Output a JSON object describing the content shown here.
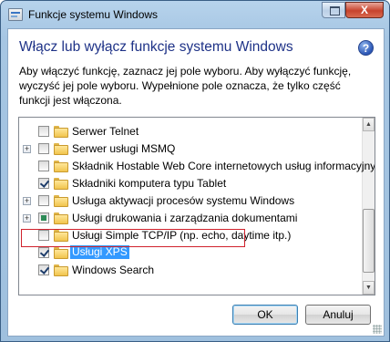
{
  "window": {
    "title": "Funkcje systemu Windows",
    "close_label": "X"
  },
  "dialog": {
    "heading": "Włącz lub wyłącz funkcje systemu Windows",
    "description": "Aby włączyć funkcję, zaznacz jej pole wyboru. Aby wyłączyć funkcję, wyczyść jej pole wyboru. Wypełnione pole oznacza, że tylko część funkcji jest włączona.",
    "help_label": "?"
  },
  "features": [
    {
      "label": "Serwer Telnet",
      "checked": false,
      "partial": false,
      "expandable": false,
      "selected": false
    },
    {
      "label": "Serwer usługi MSMQ",
      "checked": false,
      "partial": false,
      "expandable": true,
      "selected": false
    },
    {
      "label": "Składnik Hostable Web Core internetowych usług informacyjnych",
      "checked": false,
      "partial": false,
      "expandable": false,
      "selected": false
    },
    {
      "label": "Składniki komputera typu Tablet",
      "checked": true,
      "partial": false,
      "expandable": false,
      "selected": false
    },
    {
      "label": "Usługa aktywacji procesów systemu Windows",
      "checked": false,
      "partial": false,
      "expandable": true,
      "selected": false
    },
    {
      "label": "Usługi drukowania i zarządzania dokumentami",
      "checked": false,
      "partial": true,
      "expandable": true,
      "selected": false
    },
    {
      "label": "Usługi Simple TCP/IP (np. echo, daytime itp.)",
      "checked": false,
      "partial": false,
      "expandable": false,
      "selected": false
    },
    {
      "label": "Usługi XPS",
      "checked": true,
      "partial": false,
      "expandable": false,
      "selected": true
    },
    {
      "label": "Windows Search",
      "checked": true,
      "partial": false,
      "expandable": false,
      "selected": false
    }
  ],
  "buttons": {
    "ok": "OK",
    "cancel": "Anuluj"
  },
  "colors": {
    "heading": "#1e3287",
    "selection": "#3399ff",
    "highlight_box": "#d0222d"
  }
}
